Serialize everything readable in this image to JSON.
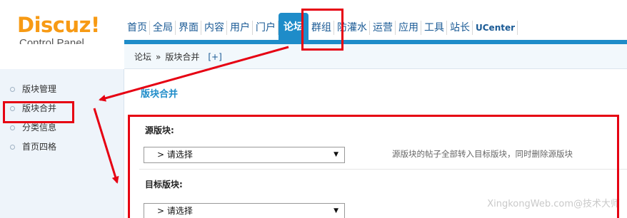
{
  "header": {
    "logo_main": "Discuz",
    "logo_bang": "!",
    "logo_sub": "Control Panel"
  },
  "nav": {
    "items": [
      {
        "label": "首页"
      },
      {
        "label": "全局"
      },
      {
        "label": "界面"
      },
      {
        "label": "内容"
      },
      {
        "label": "用户"
      },
      {
        "label": "门户"
      },
      {
        "label": "论坛",
        "active": true
      },
      {
        "label": "群组"
      },
      {
        "label": "防灌水"
      },
      {
        "label": "运营"
      },
      {
        "label": "应用"
      },
      {
        "label": "工具"
      },
      {
        "label": "站长"
      },
      {
        "label": "UCenter"
      }
    ]
  },
  "breadcrumb": {
    "section": "论坛",
    "separator": "»",
    "page": "版块合并",
    "add": "[+]"
  },
  "sidebar": {
    "items": [
      {
        "label": "版块管理"
      },
      {
        "label": "版块合并",
        "active": true
      },
      {
        "label": "分类信息"
      },
      {
        "label": "首页四格"
      }
    ]
  },
  "main": {
    "title": "版块合并",
    "source_label": "源版块:",
    "source_value": "> 请选择",
    "source_tip": "源版块的帖子全部转入目标版块，同时删除源版块",
    "target_label": "目标版块:",
    "target_value": "> 请选择"
  },
  "watermark": "XingkongWeb.com@技术大师",
  "colors": {
    "accent": "#1e8cc9",
    "logo": "#f79a14",
    "annotation": "#e60012"
  },
  "icons": {
    "select_arrow": "dropdown-arrow-icon",
    "bullet": "circle-bullet-icon"
  }
}
